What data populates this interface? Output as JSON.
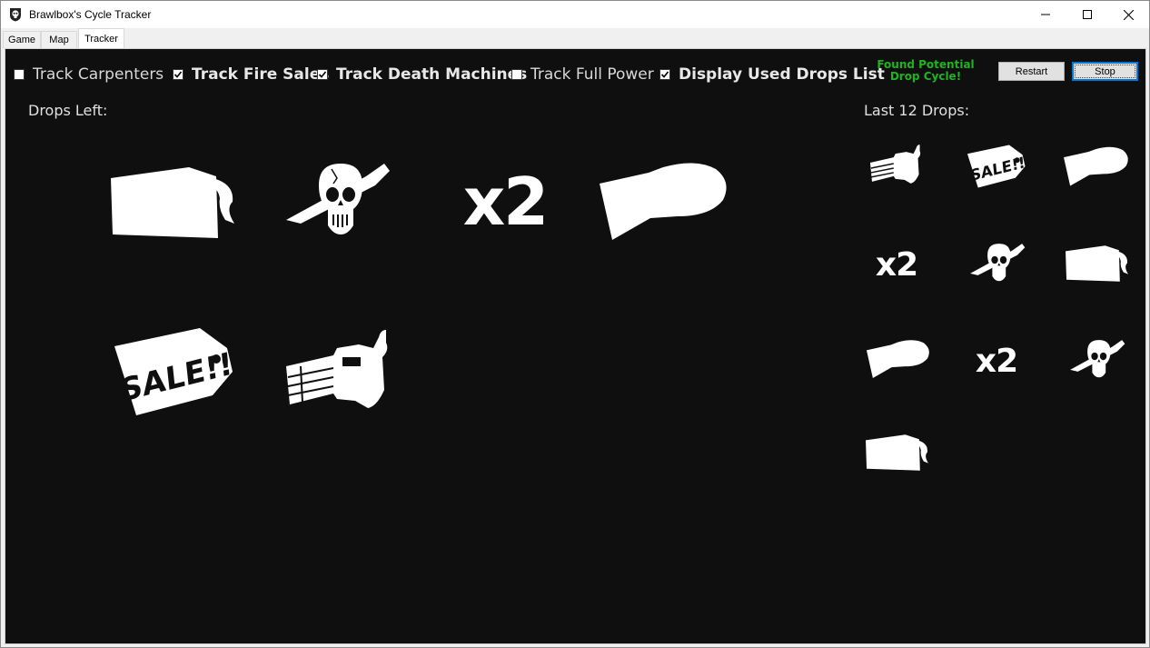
{
  "window": {
    "title": "Brawlbox's Cycle Tracker",
    "icon": "skull-shield-icon"
  },
  "tabs": [
    {
      "label": "Game",
      "active": false
    },
    {
      "label": "Map",
      "active": false
    },
    {
      "label": "Tracker",
      "active": true
    }
  ],
  "options": [
    {
      "label": "Track Carpenters",
      "checked": false
    },
    {
      "label": "Track Fire Sales",
      "checked": true
    },
    {
      "label": "Track Death Machines",
      "checked": true
    },
    {
      "label": "Track Full Power",
      "checked": false
    },
    {
      "label": "Display Used Drops List",
      "checked": true
    }
  ],
  "status": {
    "text": "Found Potential Drop Cycle!",
    "color": "#1db41d"
  },
  "buttons": {
    "restart": "Restart",
    "stop": "Stop"
  },
  "drops_left": {
    "label": "Drops Left:",
    "items": [
      {
        "icon": "nuke-icon"
      },
      {
        "icon": "insta-kill-icon"
      },
      {
        "icon": "double-points-icon",
        "text": "x2"
      },
      {
        "icon": "max-ammo-icon"
      },
      {
        "icon": "fire-sale-icon"
      },
      {
        "icon": "death-machine-icon"
      }
    ]
  },
  "last_drops": {
    "label": "Last 12 Drops:",
    "items": [
      {
        "icon": "death-machine-icon"
      },
      {
        "icon": "fire-sale-icon"
      },
      {
        "icon": "max-ammo-icon"
      },
      {
        "icon": "double-points-icon",
        "text": "x2"
      },
      {
        "icon": "insta-kill-icon"
      },
      {
        "icon": "nuke-icon"
      },
      {
        "icon": "max-ammo-icon"
      },
      {
        "icon": "double-points-icon",
        "text": "x2"
      },
      {
        "icon": "insta-kill-icon"
      },
      {
        "icon": "nuke-icon"
      }
    ]
  },
  "colors": {
    "background": "#0f0f0f",
    "text": "#e0e0e0",
    "status": "#1db41d",
    "focus": "#0078d7"
  }
}
